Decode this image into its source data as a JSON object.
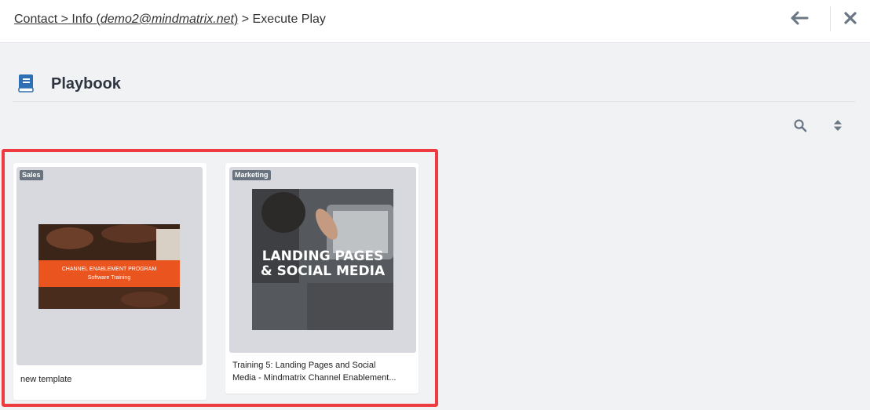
{
  "breadcrumb": {
    "contact": "Contact",
    "sep1": ">",
    "info_prefix": "Info (",
    "email": "demo2@mindmatrix.net",
    "info_suffix": ")",
    "sep2": ">",
    "current": "Execute Play"
  },
  "top_actions": {
    "back_icon": "arrow-left-icon",
    "close_icon": "close-icon"
  },
  "section": {
    "icon": "book-icon",
    "title": "Playbook",
    "tools": [
      "search-icon",
      "sort-icon"
    ]
  },
  "cards": [
    {
      "tag": "Sales",
      "title": "new template",
      "thumb_line1": "CHANNEL ENABLEMENT PROGRAM",
      "thumb_line2": "Software Training"
    },
    {
      "tag": "Marketing",
      "title_line1": "Training 5: Landing Pages and Social",
      "title_line2": "Media - Mindmatrix Channel Enablement...",
      "thumb_line1": "LANDING PAGES",
      "thumb_line2": "& SOCIAL MEDIA"
    }
  ],
  "colors": {
    "accent_blue": "#2f6fb3",
    "highlight_red": "#ee3b40",
    "banner_orange": "#e9541f"
  }
}
